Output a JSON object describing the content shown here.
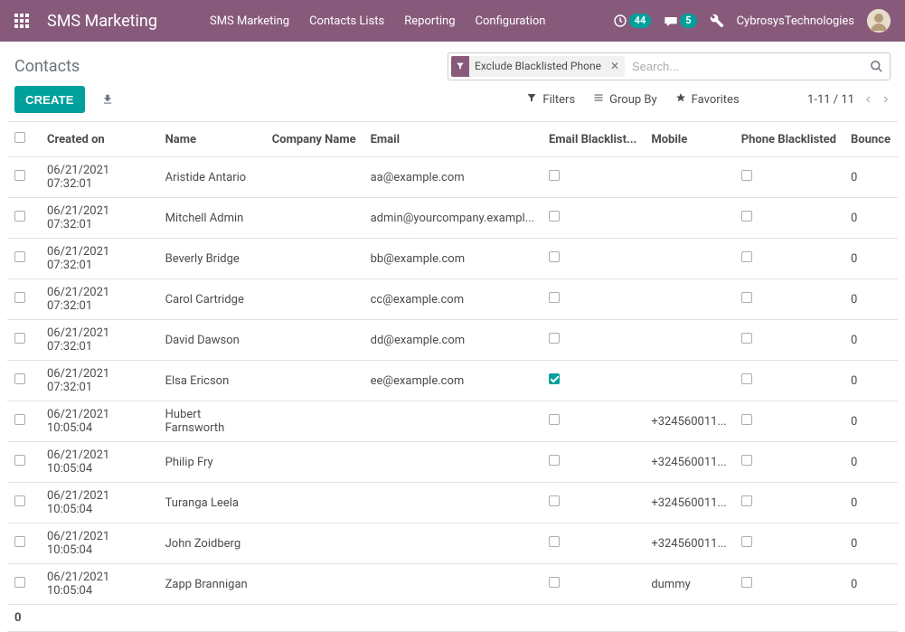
{
  "nav": {
    "brand": "SMS Marketing",
    "menu": [
      "SMS Marketing",
      "Contacts Lists",
      "Reporting",
      "Configuration"
    ],
    "activity_count": "44",
    "message_count": "5",
    "company": "CybrosysTechnologies"
  },
  "cp": {
    "breadcrumb": "Contacts",
    "filter_facet": "Exclude Blacklisted Phone",
    "search_placeholder": "Search...",
    "create": "CREATE",
    "filters": "Filters",
    "group_by": "Group By",
    "favorites": "Favorites",
    "pager": "1-11 / 11"
  },
  "table": {
    "headers": {
      "created_on": "Created on",
      "name": "Name",
      "company_name": "Company Name",
      "email": "Email",
      "email_blacklist": "Email Blacklist...",
      "mobile": "Mobile",
      "phone_blacklist": "Phone Blacklisted",
      "bounce": "Bounce"
    },
    "rows": [
      {
        "created_on": "06/21/2021 07:32:01",
        "name": "Aristide Antario",
        "company_name": "",
        "email": "aa@example.com",
        "email_blacklist": false,
        "mobile": "",
        "phone_blacklist": false,
        "bounce": "0"
      },
      {
        "created_on": "06/21/2021 07:32:01",
        "name": "Mitchell Admin",
        "company_name": "",
        "email": "admin@yourcompany.exampl...",
        "email_blacklist": false,
        "mobile": "",
        "phone_blacklist": false,
        "bounce": "0"
      },
      {
        "created_on": "06/21/2021 07:32:01",
        "name": "Beverly Bridge",
        "company_name": "",
        "email": "bb@example.com",
        "email_blacklist": false,
        "mobile": "",
        "phone_blacklist": false,
        "bounce": "0"
      },
      {
        "created_on": "06/21/2021 07:32:01",
        "name": "Carol Cartridge",
        "company_name": "",
        "email": "cc@example.com",
        "email_blacklist": false,
        "mobile": "",
        "phone_blacklist": false,
        "bounce": "0"
      },
      {
        "created_on": "06/21/2021 07:32:01",
        "name": "David Dawson",
        "company_name": "",
        "email": "dd@example.com",
        "email_blacklist": false,
        "mobile": "",
        "phone_blacklist": false,
        "bounce": "0"
      },
      {
        "created_on": "06/21/2021 07:32:01",
        "name": "Elsa Ericson",
        "company_name": "",
        "email": "ee@example.com",
        "email_blacklist": true,
        "mobile": "",
        "phone_blacklist": false,
        "bounce": "0"
      },
      {
        "created_on": "06/21/2021 10:05:04",
        "name": "Hubert Farnsworth",
        "company_name": "",
        "email": "",
        "email_blacklist": false,
        "mobile": "+324560011...",
        "phone_blacklist": false,
        "bounce": "0"
      },
      {
        "created_on": "06/21/2021 10:05:04",
        "name": "Philip Fry",
        "company_name": "",
        "email": "",
        "email_blacklist": false,
        "mobile": "+324560011...",
        "phone_blacklist": false,
        "bounce": "0"
      },
      {
        "created_on": "06/21/2021 10:05:04",
        "name": "Turanga Leela",
        "company_name": "",
        "email": "",
        "email_blacklist": false,
        "mobile": "+324560011...",
        "phone_blacklist": false,
        "bounce": "0"
      },
      {
        "created_on": "06/21/2021 10:05:04",
        "name": "John Zoidberg",
        "company_name": "",
        "email": "",
        "email_blacklist": false,
        "mobile": "+324560011...",
        "phone_blacklist": false,
        "bounce": "0"
      },
      {
        "created_on": "06/21/2021 10:05:04",
        "name": "Zapp Brannigan",
        "company_name": "",
        "email": "",
        "email_blacklist": false,
        "mobile": "dummy",
        "phone_blacklist": false,
        "bounce": "0"
      }
    ],
    "footer_total": "0"
  }
}
